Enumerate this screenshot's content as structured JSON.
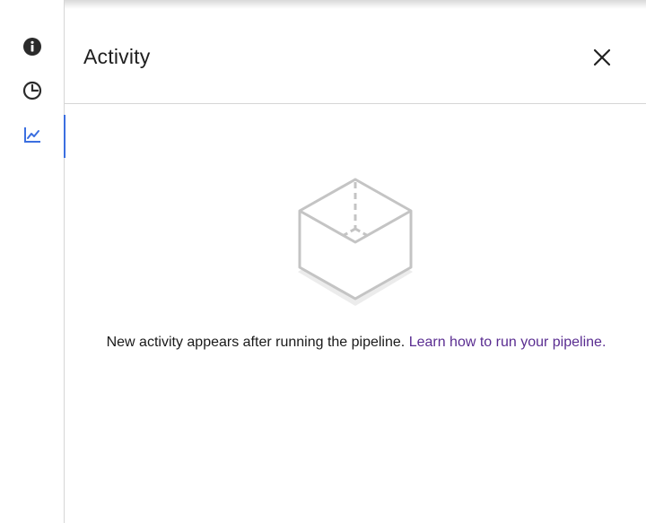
{
  "rail": {
    "items": [
      {
        "icon": "info-icon"
      },
      {
        "icon": "clock-icon"
      },
      {
        "icon": "activity-chart-icon",
        "active": true
      }
    ],
    "accent_color": "#3b6fe0"
  },
  "panel": {
    "title": "Activity",
    "close_icon": "close-icon"
  },
  "empty_state": {
    "icon": "empty-box-icon",
    "message": "New activity appears after running the pipeline.",
    "link_text": "Learn how to run your pipeline.",
    "link_color": "#5a2d91"
  }
}
